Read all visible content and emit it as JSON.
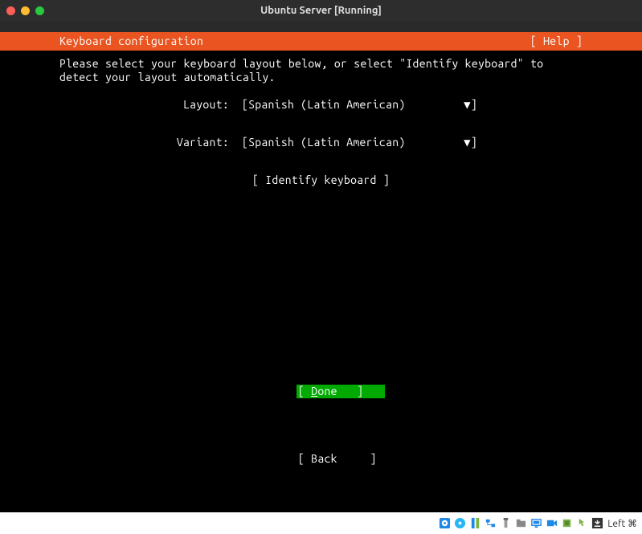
{
  "window": {
    "title": "Ubuntu Server [Running]"
  },
  "header": {
    "title": "Keyboard configuration",
    "help": "[ Help ]"
  },
  "instructions": {
    "line1": "Please select your keyboard layout below, or select \"Identify keyboard\" to",
    "line2": "detect your layout automatically."
  },
  "form": {
    "layout_label": "Layout:",
    "layout_value": "Spanish (Latin American)",
    "variant_label": "Variant:",
    "variant_value": "Spanish (Latin American)",
    "identify_label": "[ Identify keyboard ]"
  },
  "footer": {
    "done_prefix": "[ ",
    "done_char": "D",
    "done_rest": "one",
    "done_suffix": "   ]",
    "back": "[ Back     ]"
  },
  "statusbar": {
    "host_key": "Left ⌘"
  }
}
